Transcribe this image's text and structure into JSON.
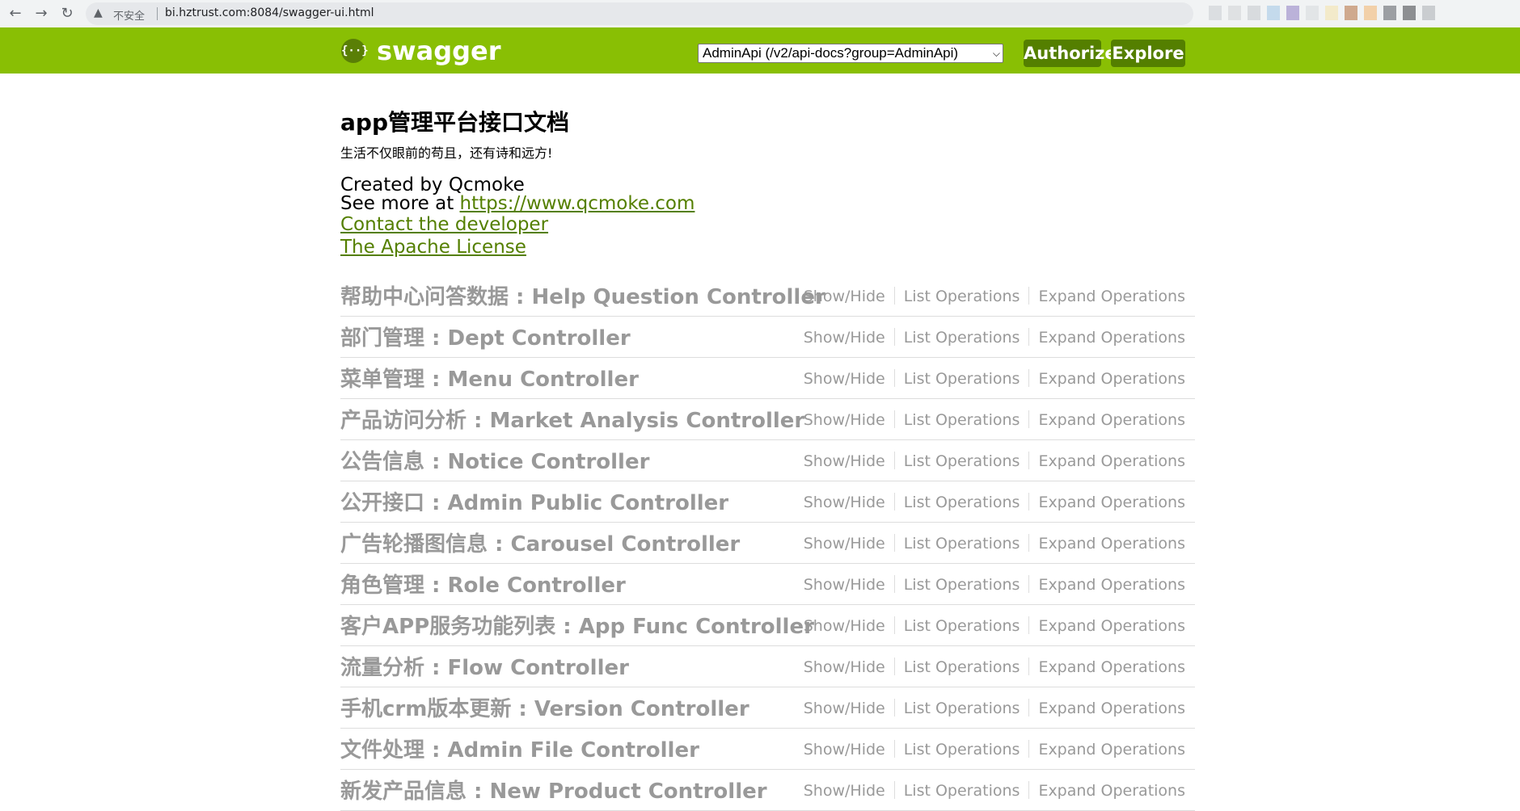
{
  "browser": {
    "back_icon": "←",
    "forward_icon": "→",
    "reload_icon": "↻",
    "security_icon": "▲",
    "insecure_label": "不安全",
    "url": "bi.hztrust.com:8084/swagger-ui.html"
  },
  "header": {
    "logo_mark": "{··}",
    "logo_text": "swagger",
    "api_select_value": "AdminApi (/v2/api-docs?group=AdminApi)",
    "authorize_label": "Authorize",
    "explore_label": "Explore",
    "colors": {
      "bar": "#89bf04",
      "button": "#547f00"
    }
  },
  "info": {
    "title": "app管理平台接口文档",
    "description": "生活不仅眼前的苟且，还有诗和远方!",
    "created_by": "Created by Qcmoke",
    "see_more_prefix": "See more at ",
    "see_more_link": "https://www.qcmoke.com",
    "contact_link": "Contact the developer",
    "license_link": "The Apache License"
  },
  "operations_labels": {
    "show_hide": "Show/Hide",
    "list": "List Operations",
    "expand": "Expand Operations"
  },
  "resources": [
    "帮助中心问答数据 : Help Question Controller",
    "部门管理 : Dept Controller",
    "菜单管理 : Menu Controller",
    "产品访问分析 : Market Analysis Controller",
    "公告信息 : Notice Controller",
    "公开接口 : Admin Public Controller",
    "广告轮播图信息 : Carousel Controller",
    "角色管理 : Role Controller",
    "客户APP服务功能列表 : App Func Controller",
    "流量分析 : Flow Controller",
    "手机crm版本更新 : Version Controller",
    "文件处理 : Admin File Controller",
    "新发产品信息 : New Product Controller"
  ]
}
